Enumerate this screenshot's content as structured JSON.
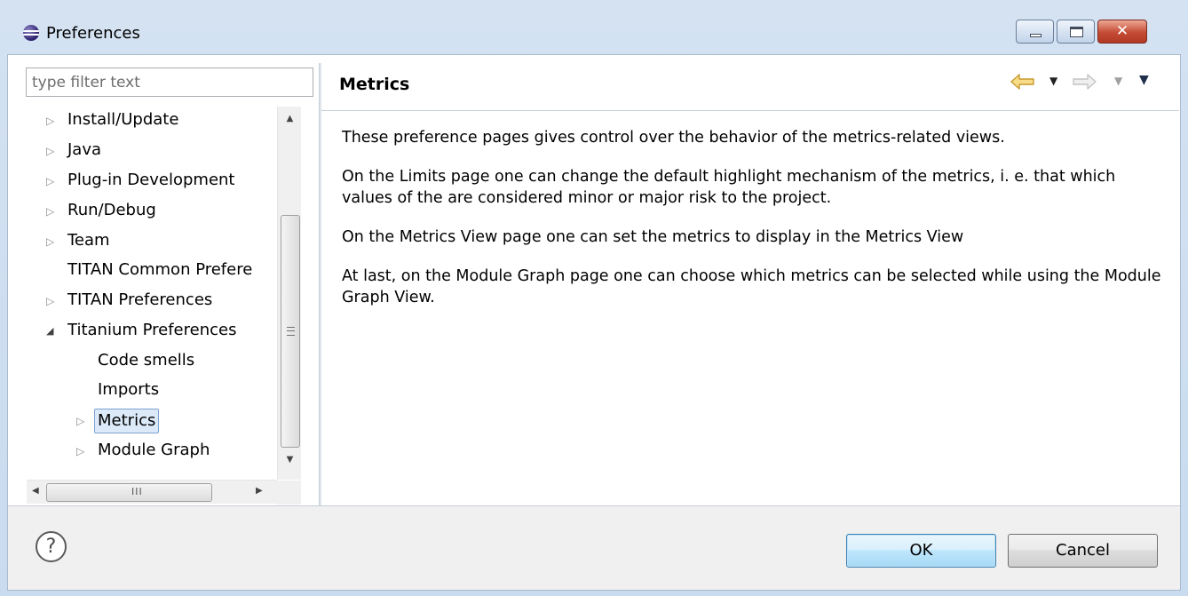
{
  "window": {
    "title": "Preferences",
    "close_glyph": "✕"
  },
  "filter": {
    "placeholder": "type filter text",
    "value": ""
  },
  "tree": {
    "items": [
      {
        "label": "Install/Update",
        "twisty": "collapsed"
      },
      {
        "label": "Java",
        "twisty": "collapsed"
      },
      {
        "label": "Plug-in Development",
        "twisty": "collapsed"
      },
      {
        "label": "Run/Debug",
        "twisty": "collapsed"
      },
      {
        "label": "Team",
        "twisty": "collapsed"
      },
      {
        "label": "TITAN Common Prefere",
        "twisty": "none"
      },
      {
        "label": "TITAN Preferences",
        "twisty": "collapsed"
      },
      {
        "label": "Titanium Preferences",
        "twisty": "expanded"
      },
      {
        "label": "Code smells",
        "twisty": "none"
      },
      {
        "label": "Imports",
        "twisty": "none"
      },
      {
        "label": "Metrics",
        "twisty": "collapsed",
        "selected": true
      },
      {
        "label": "Module Graph",
        "twisty": "collapsed"
      }
    ],
    "hscroll_grip": "III"
  },
  "page": {
    "title": "Metrics",
    "paragraphs": [
      "These preference pages gives control over the behavior of the metrics-related views.",
      "On the Limits page one can change the default highlight mechanism of the metrics, i. e. that which values of the are considered minor or major risk to the project.",
      "On the Metrics View page one can set the metrics to display in the Metrics View",
      "At last, on the Module Graph page one can choose which metrics can be selected while using the Module Graph View."
    ]
  },
  "buttons": {
    "help": "?",
    "ok": "OK",
    "cancel": "Cancel"
  },
  "colors": {
    "back_arrow": "#e8b84a",
    "forward_arrow_disabled": "#c8c8c8",
    "selection_bg": "#dbe9f8"
  }
}
